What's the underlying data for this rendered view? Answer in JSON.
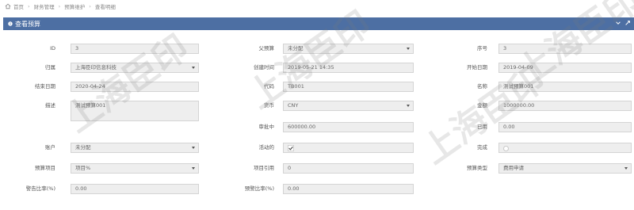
{
  "breadcrumb": {
    "items": [
      "首页",
      "财务管理",
      "预算维护",
      "查看明细"
    ]
  },
  "panel": {
    "title": "查看预算"
  },
  "fields": {
    "id": {
      "label": "ID",
      "value": "3"
    },
    "parent_budget": {
      "label": "父预算",
      "value": "未分配"
    },
    "seq": {
      "label": "序号",
      "value": "3"
    },
    "owner": {
      "label": "归属",
      "value": "上海臣印信息科技"
    },
    "created_time": {
      "label": "创建时间",
      "value": "2019-05-21 14:35"
    },
    "start_date": {
      "label": "开始日期",
      "value": "2019-04-09"
    },
    "end_date": {
      "label": "结束日期",
      "value": "2020-04-24"
    },
    "code": {
      "label": "代码",
      "value": "TB001"
    },
    "name": {
      "label": "名称",
      "value": "测试预算001"
    },
    "description": {
      "label": "描述",
      "value": "测试预算001"
    },
    "currency": {
      "label": "货币",
      "value": "CNY"
    },
    "amount": {
      "label": "金额",
      "value": "1000000.00"
    },
    "approving": {
      "label": "审批中",
      "value": "600000.00"
    },
    "used": {
      "label": "已用",
      "value": "0.00"
    },
    "account": {
      "label": "账户",
      "value": "未分配"
    },
    "active": {
      "label": "活动的",
      "checked": true
    },
    "done": {
      "label": "完成",
      "checked": false
    },
    "budget_item": {
      "label": "预算项目",
      "value": "项目%"
    },
    "item_ref": {
      "label": "项目引用",
      "value": "0"
    },
    "budget_type": {
      "label": "预算类型",
      "value": "费用申请"
    },
    "warn_ratio": {
      "label": "警告比率(%)",
      "value": "0.00"
    },
    "alert_ratio": {
      "label": "预警比率(%)",
      "value": "0.00"
    }
  },
  "watermark": {
    "text": "上海臣印"
  }
}
